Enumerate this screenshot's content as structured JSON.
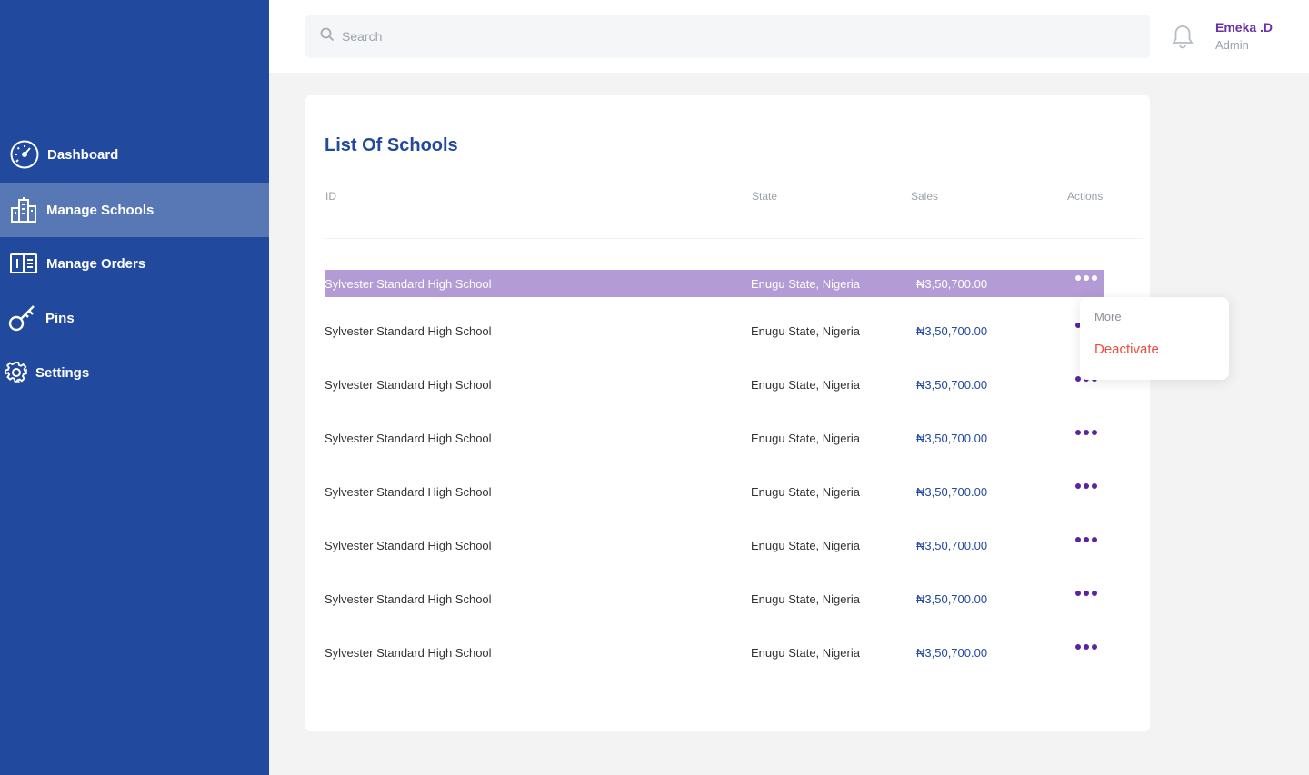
{
  "sidebar": {
    "items": [
      {
        "label": "Dashboard",
        "icon": "speedometer-icon",
        "active": false
      },
      {
        "label": "Manage Schools",
        "icon": "school-building-icon",
        "active": true
      },
      {
        "label": "Manage Orders",
        "icon": "orders-book-icon",
        "active": false
      },
      {
        "label": "Pins",
        "icon": "key-icon",
        "active": false
      },
      {
        "label": "Settings",
        "icon": "gear-icon",
        "active": false
      }
    ]
  },
  "header": {
    "search": {
      "placeholder": "Search",
      "value": ""
    },
    "user": {
      "name": "Emeka .D",
      "role": "Admin"
    }
  },
  "main": {
    "title": "List Of Schools",
    "columns": [
      "ID",
      "State",
      "Sales",
      "Actions"
    ],
    "rows": [
      {
        "name": "Sylvester Standard High School",
        "state": "Enugu State, Nigeria",
        "sales": "₦3,50,700.00",
        "selected": true
      },
      {
        "name": "Sylvester Standard High School",
        "state": "Enugu State, Nigeria",
        "sales": "₦3,50,700.00",
        "selected": false
      },
      {
        "name": "Sylvester Standard High School",
        "state": "Enugu State, Nigeria",
        "sales": "₦3,50,700.00",
        "selected": false
      },
      {
        "name": "Sylvester Standard High School",
        "state": "Enugu State, Nigeria",
        "sales": "₦3,50,700.00",
        "selected": false
      },
      {
        "name": "Sylvester Standard High School",
        "state": "Enugu State, Nigeria",
        "sales": "₦3,50,700.00",
        "selected": false
      },
      {
        "name": "Sylvester Standard High School",
        "state": "Enugu State, Nigeria",
        "sales": "₦3,50,700.00",
        "selected": false
      },
      {
        "name": "Sylvester Standard High School",
        "state": "Enugu State, Nigeria",
        "sales": "₦3,50,700.00",
        "selected": false
      },
      {
        "name": "Sylvester Standard High School",
        "state": "Enugu State, Nigeria",
        "sales": "₦3,50,700.00",
        "selected": false
      }
    ]
  },
  "dropdown": {
    "title": "More",
    "items": [
      "Deactivate"
    ]
  },
  "colors": {
    "sidebar": "#21499e",
    "sidebar_active": "#5878b5",
    "accent_purple": "#6b2fa8",
    "selected_row": "#b39cd5",
    "danger": "#ef4b3f"
  }
}
